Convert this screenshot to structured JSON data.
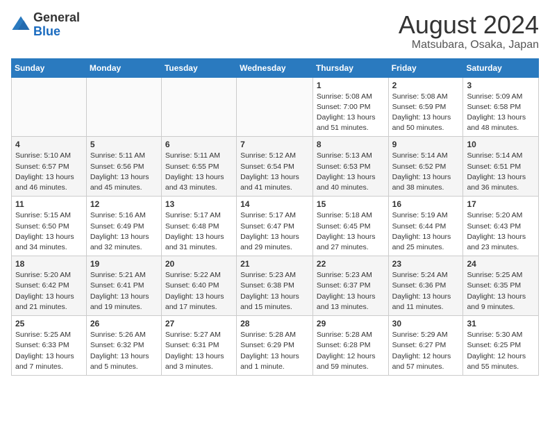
{
  "header": {
    "logo_line1": "General",
    "logo_line2": "Blue",
    "title": "August 2024",
    "subtitle": "Matsubara, Osaka, Japan"
  },
  "weekdays": [
    "Sunday",
    "Monday",
    "Tuesday",
    "Wednesday",
    "Thursday",
    "Friday",
    "Saturday"
  ],
  "weeks": [
    [
      {
        "day": "",
        "text": ""
      },
      {
        "day": "",
        "text": ""
      },
      {
        "day": "",
        "text": ""
      },
      {
        "day": "",
        "text": ""
      },
      {
        "day": "1",
        "text": "Sunrise: 5:08 AM\nSunset: 7:00 PM\nDaylight: 13 hours and 51 minutes."
      },
      {
        "day": "2",
        "text": "Sunrise: 5:08 AM\nSunset: 6:59 PM\nDaylight: 13 hours and 50 minutes."
      },
      {
        "day": "3",
        "text": "Sunrise: 5:09 AM\nSunset: 6:58 PM\nDaylight: 13 hours and 48 minutes."
      }
    ],
    [
      {
        "day": "4",
        "text": "Sunrise: 5:10 AM\nSunset: 6:57 PM\nDaylight: 13 hours and 46 minutes."
      },
      {
        "day": "5",
        "text": "Sunrise: 5:11 AM\nSunset: 6:56 PM\nDaylight: 13 hours and 45 minutes."
      },
      {
        "day": "6",
        "text": "Sunrise: 5:11 AM\nSunset: 6:55 PM\nDaylight: 13 hours and 43 minutes."
      },
      {
        "day": "7",
        "text": "Sunrise: 5:12 AM\nSunset: 6:54 PM\nDaylight: 13 hours and 41 minutes."
      },
      {
        "day": "8",
        "text": "Sunrise: 5:13 AM\nSunset: 6:53 PM\nDaylight: 13 hours and 40 minutes."
      },
      {
        "day": "9",
        "text": "Sunrise: 5:14 AM\nSunset: 6:52 PM\nDaylight: 13 hours and 38 minutes."
      },
      {
        "day": "10",
        "text": "Sunrise: 5:14 AM\nSunset: 6:51 PM\nDaylight: 13 hours and 36 minutes."
      }
    ],
    [
      {
        "day": "11",
        "text": "Sunrise: 5:15 AM\nSunset: 6:50 PM\nDaylight: 13 hours and 34 minutes."
      },
      {
        "day": "12",
        "text": "Sunrise: 5:16 AM\nSunset: 6:49 PM\nDaylight: 13 hours and 32 minutes."
      },
      {
        "day": "13",
        "text": "Sunrise: 5:17 AM\nSunset: 6:48 PM\nDaylight: 13 hours and 31 minutes."
      },
      {
        "day": "14",
        "text": "Sunrise: 5:17 AM\nSunset: 6:47 PM\nDaylight: 13 hours and 29 minutes."
      },
      {
        "day": "15",
        "text": "Sunrise: 5:18 AM\nSunset: 6:45 PM\nDaylight: 13 hours and 27 minutes."
      },
      {
        "day": "16",
        "text": "Sunrise: 5:19 AM\nSunset: 6:44 PM\nDaylight: 13 hours and 25 minutes."
      },
      {
        "day": "17",
        "text": "Sunrise: 5:20 AM\nSunset: 6:43 PM\nDaylight: 13 hours and 23 minutes."
      }
    ],
    [
      {
        "day": "18",
        "text": "Sunrise: 5:20 AM\nSunset: 6:42 PM\nDaylight: 13 hours and 21 minutes."
      },
      {
        "day": "19",
        "text": "Sunrise: 5:21 AM\nSunset: 6:41 PM\nDaylight: 13 hours and 19 minutes."
      },
      {
        "day": "20",
        "text": "Sunrise: 5:22 AM\nSunset: 6:40 PM\nDaylight: 13 hours and 17 minutes."
      },
      {
        "day": "21",
        "text": "Sunrise: 5:23 AM\nSunset: 6:38 PM\nDaylight: 13 hours and 15 minutes."
      },
      {
        "day": "22",
        "text": "Sunrise: 5:23 AM\nSunset: 6:37 PM\nDaylight: 13 hours and 13 minutes."
      },
      {
        "day": "23",
        "text": "Sunrise: 5:24 AM\nSunset: 6:36 PM\nDaylight: 13 hours and 11 minutes."
      },
      {
        "day": "24",
        "text": "Sunrise: 5:25 AM\nSunset: 6:35 PM\nDaylight: 13 hours and 9 minutes."
      }
    ],
    [
      {
        "day": "25",
        "text": "Sunrise: 5:25 AM\nSunset: 6:33 PM\nDaylight: 13 hours and 7 minutes."
      },
      {
        "day": "26",
        "text": "Sunrise: 5:26 AM\nSunset: 6:32 PM\nDaylight: 13 hours and 5 minutes."
      },
      {
        "day": "27",
        "text": "Sunrise: 5:27 AM\nSunset: 6:31 PM\nDaylight: 13 hours and 3 minutes."
      },
      {
        "day": "28",
        "text": "Sunrise: 5:28 AM\nSunset: 6:29 PM\nDaylight: 13 hours and 1 minute."
      },
      {
        "day": "29",
        "text": "Sunrise: 5:28 AM\nSunset: 6:28 PM\nDaylight: 12 hours and 59 minutes."
      },
      {
        "day": "30",
        "text": "Sunrise: 5:29 AM\nSunset: 6:27 PM\nDaylight: 12 hours and 57 minutes."
      },
      {
        "day": "31",
        "text": "Sunrise: 5:30 AM\nSunset: 6:25 PM\nDaylight: 12 hours and 55 minutes."
      }
    ]
  ]
}
